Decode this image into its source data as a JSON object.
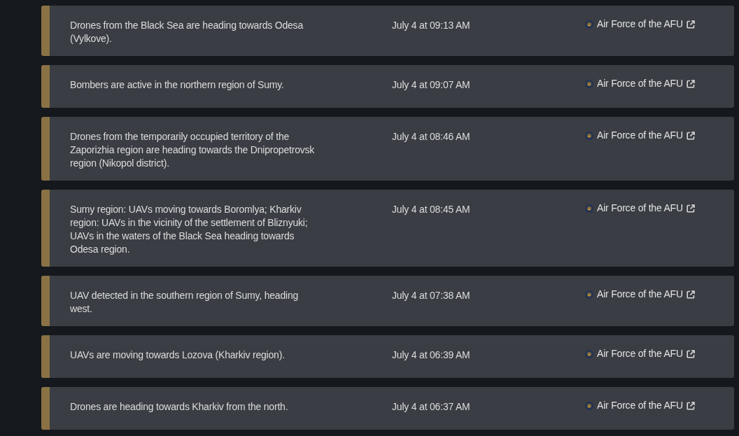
{
  "alerts": [
    {
      "message": "Drones from the Black Sea are heading towards Odesa (Vylkove).",
      "time": "July 4 at 09:13 AM",
      "source": "Air Force of the AFU"
    },
    {
      "message": "Bombers are active in the northern region of Sumy.",
      "time": "July 4 at 09:07 AM",
      "source": "Air Force of the AFU"
    },
    {
      "message": "Drones from the temporarily occupied territory of the Zaporizhia region are heading towards the Dnipropetrovsk region (Nikopol district).",
      "time": "July 4 at 08:46 AM",
      "source": "Air Force of the AFU"
    },
    {
      "message": "Sumy region: UAVs moving towards Boromlya; Kharkiv region: UAVs in the vicinity of the settlement of Bliznyuki; UAVs in the waters of the Black Sea heading towards Odesa region.",
      "time": "July 4 at 08:45 AM",
      "source": "Air Force of the AFU"
    },
    {
      "message": "UAV detected in the southern region of Sumy, heading west.",
      "time": "July 4 at 07:38 AM",
      "source": "Air Force of the AFU"
    },
    {
      "message": "UAVs are moving towards Lozova (Kharkiv region).",
      "time": "July 4 at 06:39 AM",
      "source": "Air Force of the AFU"
    },
    {
      "message": "Drones are heading towards Kharkiv from the north.",
      "time": "July 4 at 06:37 AM",
      "source": "Air Force of the AFU"
    }
  ]
}
